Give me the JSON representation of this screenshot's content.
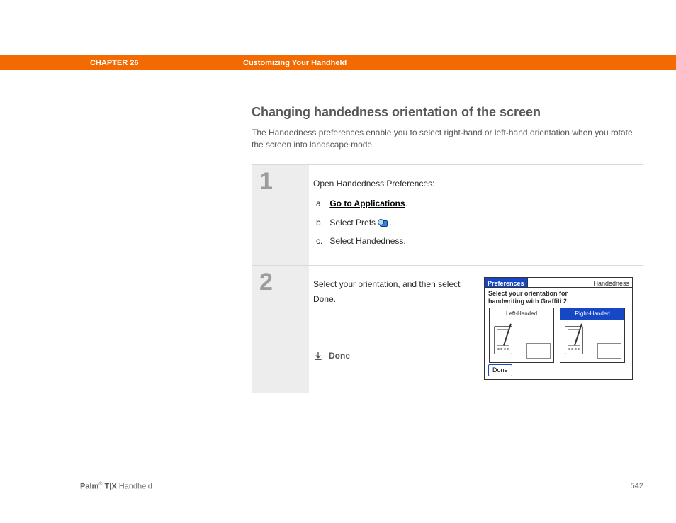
{
  "header": {
    "chapter": "CHAPTER 26",
    "breadcrumb": "Customizing Your Handheld"
  },
  "section": {
    "title": "Changing handedness orientation of the screen",
    "intro": "The Handedness preferences enable you to select right-hand or left-hand orientation when you rotate the screen into landscape mode."
  },
  "steps": {
    "s1": {
      "num": "1",
      "lead": "Open Handedness Preferences:",
      "a_letter": "a.",
      "a_link": "Go to Applications",
      "a_period": ".",
      "b_letter": "b.",
      "b_text_before": "Select Prefs ",
      "b_period": ".",
      "c_letter": "c.",
      "c_text": "Select Handedness."
    },
    "s2": {
      "num": "2",
      "text": "Select your orientation, and then select Done.",
      "done_label": "Done"
    }
  },
  "mock": {
    "titlebar_pref": "Preferences",
    "titlebar_handedness": "Handedness",
    "msg_l1": "Select your orientation for",
    "msg_l2": "handwriting with Graffiti 2:",
    "opt_left": "Left-Handed",
    "opt_right": "Right-Handed",
    "done": "Done"
  },
  "footer": {
    "brand_bold": "Palm",
    "brand_reg": "®",
    "brand_model": " T|X",
    "brand_rest": " Handheld",
    "page": "542"
  }
}
